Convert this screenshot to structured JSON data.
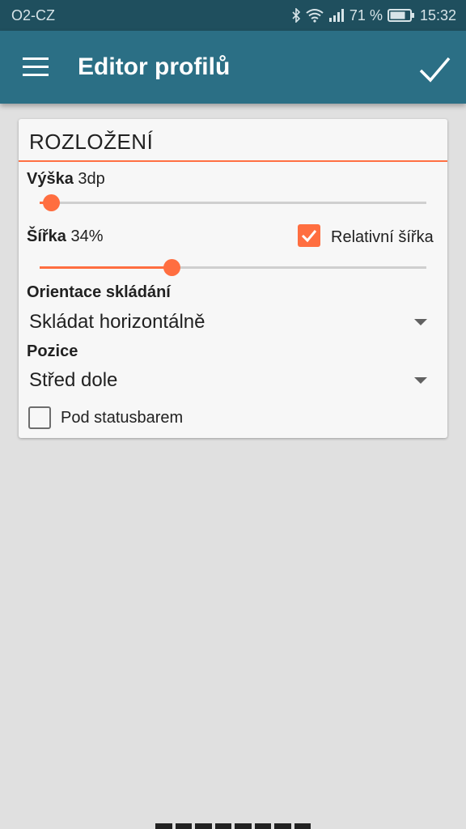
{
  "status_bar": {
    "carrier": "O2-CZ",
    "battery_percent": "71 %",
    "time": "15:32",
    "icons": [
      "bluetooth-icon",
      "wifi-icon",
      "signal-icon",
      "battery-icon"
    ]
  },
  "app_bar": {
    "title": "Editor profilů",
    "menu_icon": "hamburger-menu-icon",
    "confirm_icon": "checkmark-icon"
  },
  "card": {
    "title": "ROZLOŽENÍ",
    "height": {
      "label": "Výška",
      "value": "3dp",
      "slider_fraction": 0.03
    },
    "width": {
      "label": "Šířka",
      "value": "34%",
      "slider_fraction": 0.34
    },
    "relative_width": {
      "label": "Relativní šířka",
      "checked": true
    },
    "orientation": {
      "label": "Orientace skládání",
      "value": "Skládat horizontálně"
    },
    "position": {
      "label": "Pozice",
      "value": "Střed dole"
    },
    "under_statusbar": {
      "label": "Pod statusbarem",
      "checked": false
    }
  },
  "colors": {
    "accent": "#ff6e40",
    "app_bar": "#2b6f85",
    "status_bar": "#1f4f5e",
    "background": "#e0e0e0"
  }
}
